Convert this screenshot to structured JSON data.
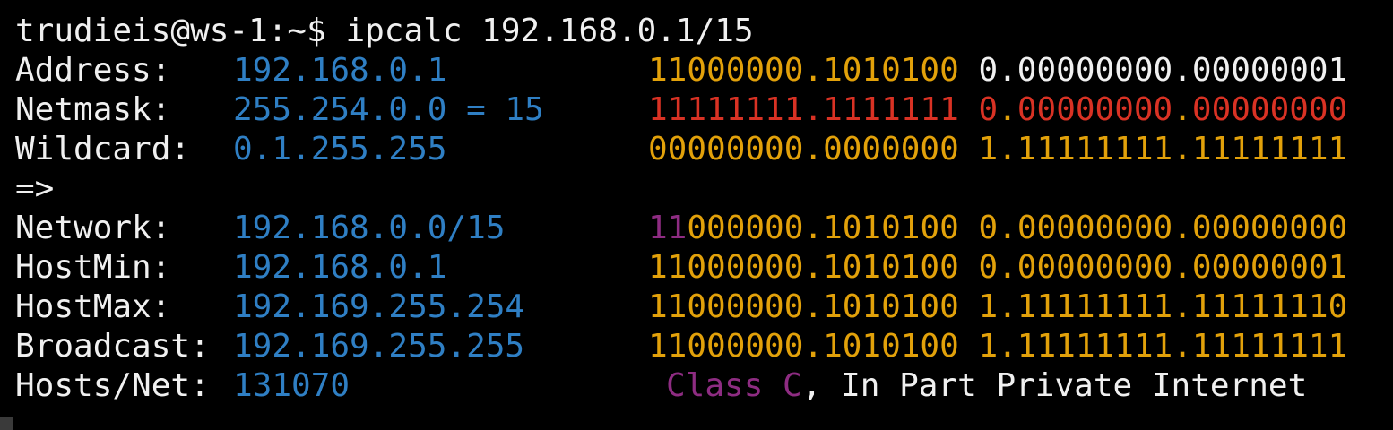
{
  "command_line": "trudieis@ws-1:~$ ipcalc 192.168.0.1/15",
  "rows": {
    "address": {
      "label": "Address:",
      "value": "192.168.0.1",
      "bin_prefix": "11000000.1010100",
      "bin_suffix": " 0.00000000.00000001"
    },
    "netmask": {
      "label": "Netmask:",
      "value": "255.254.0.0 = 15",
      "bin_prefix": "11111111.1111111",
      "bin_space": " ",
      "bin_bit": "0",
      "bin_dot1": ".",
      "bin_mid": "00000000",
      "bin_dot2": ".",
      "bin_end": "00000000"
    },
    "wildcard": {
      "label": "Wildcard:",
      "value": "0.1.255.255",
      "bin_prefix": "00000000.0000000",
      "bin_suffix": " 1.11111111.11111111"
    },
    "arrow": {
      "label": "=>"
    },
    "network": {
      "label": "Network:",
      "value": "192.168.0.0/15",
      "bin_class_bits": "11",
      "bin_prefix": "000000.1010100",
      "bin_suffix": " 0.00000000.00000000"
    },
    "hostmin": {
      "label": "HostMin:",
      "value": "192.168.0.1",
      "bin_prefix": "11000000.1010100",
      "bin_suffix": " 0.00000000.00000001"
    },
    "hostmax": {
      "label": "HostMax:",
      "value": "192.169.255.254",
      "bin_prefix": "11000000.1010100",
      "bin_suffix": " 1.11111111.11111110"
    },
    "broadcast": {
      "label": "Broadcast:",
      "value": "192.169.255.255",
      "bin_prefix": "11000000.1010100",
      "bin_suffix": " 1.11111111.11111111"
    },
    "hosts": {
      "label": "Hosts/Net:",
      "value": "131070",
      "class_label": "Class C",
      "class_note": ", In Part Private Internet"
    }
  },
  "colors": {
    "background": "#000000",
    "text": "#f0f0f0",
    "ip": "#2f7fc4",
    "binary": "#e2a10a",
    "netmask_binary": "#d93224",
    "class": "#8e2c82"
  }
}
